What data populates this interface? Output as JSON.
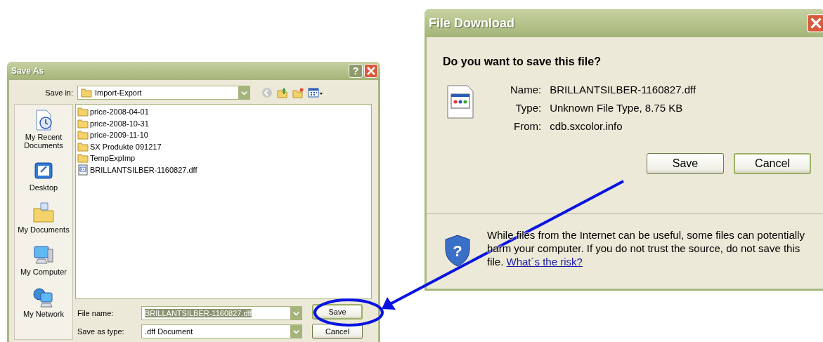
{
  "save_as": {
    "title": "Save As",
    "help_glyph": "?",
    "save_in_label": "Save in:",
    "save_in_value": "Import-Export",
    "places": [
      {
        "label": "My Recent Documents",
        "kind": "recent"
      },
      {
        "label": "Desktop",
        "kind": "desktop"
      },
      {
        "label": "My Documents",
        "kind": "documents"
      },
      {
        "label": "My Computer",
        "kind": "computer"
      },
      {
        "label": "My Network",
        "kind": "network"
      }
    ],
    "files": [
      {
        "name": "price-2008-04-01",
        "kind": "folder"
      },
      {
        "name": "price-2008-10-31",
        "kind": "folder"
      },
      {
        "name": "price-2009-11-10",
        "kind": "folder"
      },
      {
        "name": "SX Produkte 091217",
        "kind": "folder"
      },
      {
        "name": "TempExpImp",
        "kind": "folder"
      },
      {
        "name": "BRILLANTSILBER-1160827.dff",
        "kind": "file"
      }
    ],
    "file_name_label": "File name:",
    "file_name_value": "BRILLANTSILBER-1160827.dff",
    "save_type_label": "Save as type:",
    "save_type_value": ".dff Document",
    "buttons": [
      "Save",
      "Cancel"
    ]
  },
  "file_download": {
    "title": "File Download",
    "question": "Do you want to save this file?",
    "details": [
      {
        "label": "Name:",
        "value": "BRILLANTSILBER-1160827.dff"
      },
      {
        "label": "Type:",
        "value": "Unknown File Type, 8.75 KB"
      },
      {
        "label": "From:",
        "value": "cdb.sxcolor.info"
      }
    ],
    "buttons": [
      "Save",
      "Cancel"
    ],
    "warning": "While files from the Internet can be useful, some files can potentially harm your computer. If you do not trust the source, do not save this file.",
    "link": "What´s the risk?",
    "shield_glyph": "?"
  }
}
